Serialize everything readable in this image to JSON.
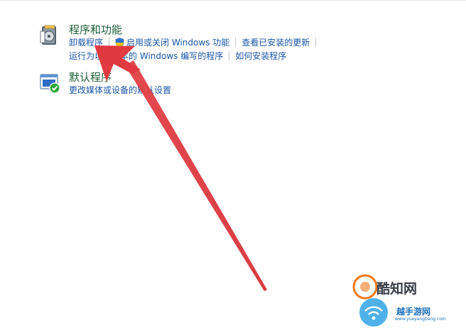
{
  "programs": {
    "title": "程序和功能",
    "icon": "programs-features-icon",
    "links_row1": [
      "卸载程序",
      "启用或关闭 Windows 功能",
      "查看已安装的更新"
    ],
    "links_row2": [
      "运行为以前版本的 Windows 编写的程序",
      "如何安装程序"
    ]
  },
  "defaults": {
    "title": "默认程序",
    "icon": "default-programs-icon",
    "link": "更改媒体或设备的默认设置"
  },
  "annotation": {
    "arrow_color": "#e0393f",
    "arrow_target": "卸载程序"
  },
  "watermark": {
    "brand": "酷知网",
    "brand2": "越手游网",
    "url": "www.yueyangbang.com"
  },
  "colors": {
    "title_green": "#1e5f3a",
    "link_blue": "#1a56a6",
    "arrow_red": "#e0393f"
  }
}
